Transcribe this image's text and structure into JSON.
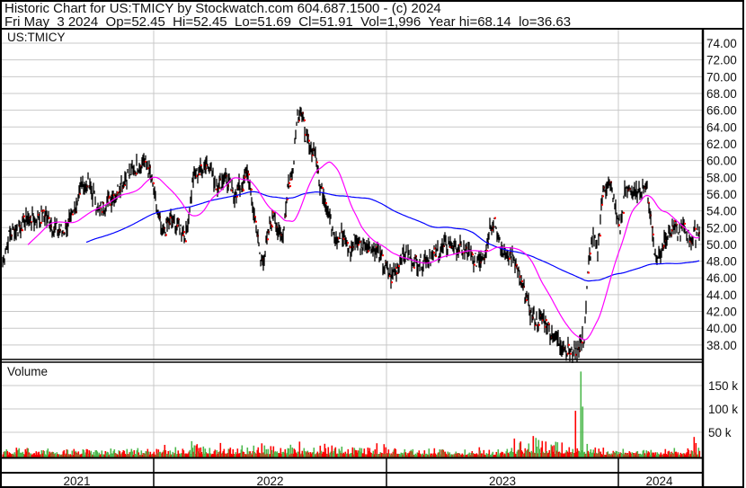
{
  "header": {
    "title": "Historic Chart for US:TMICY by Stockwatch.com 604.687.1500 - (c) 2024",
    "quote": "Fri May  3 2024  Op=52.45  Hi=52.45  Lo=51.69  Cl=51.91  Vol=1,996  Year hi=68.14  lo=36.63"
  },
  "chart_data": {
    "type": "line",
    "title": "US:TMICY",
    "price_panel": {
      "symbol_label": "US:TMICY",
      "ylim": [
        37,
        75
      ],
      "yticks": [
        "74.00",
        "72.00",
        "70.00",
        "68.00",
        "66.00",
        "64.00",
        "62.00",
        "60.00",
        "58.00",
        "56.00",
        "54.00",
        "52.00",
        "50.00",
        "48.00",
        "46.00",
        "44.00",
        "42.00",
        "40.00",
        "38.00"
      ],
      "x_day": [
        0,
        7,
        17,
        27,
        37,
        47,
        57,
        67,
        77,
        87,
        97,
        107,
        117,
        127,
        137,
        147,
        157,
        162,
        167,
        172,
        177,
        187,
        197,
        204,
        212,
        222,
        229,
        237,
        247,
        257,
        267,
        272,
        277,
        282,
        287,
        292,
        297,
        302,
        307,
        312,
        317,
        322,
        327,
        332,
        337,
        342,
        347,
        352,
        357,
        362,
        367,
        372,
        377,
        382,
        387,
        392,
        397,
        407,
        417,
        427,
        432,
        437,
        447,
        457,
        467,
        477,
        487,
        497,
        507,
        517,
        527,
        537,
        542,
        547,
        552,
        557,
        562,
        567,
        572,
        577,
        582,
        587,
        592,
        597,
        602,
        607,
        612,
        617,
        622,
        627,
        632,
        637,
        642,
        647,
        652,
        657,
        662,
        667,
        672,
        677,
        682,
        687,
        692,
        697,
        702,
        707,
        712,
        717,
        722,
        727,
        732,
        737,
        742,
        747,
        752,
        757,
        762,
        767,
        772,
        775
      ],
      "close": [
        48,
        51,
        52,
        53,
        53,
        53.5,
        52,
        51.5,
        53,
        57,
        57,
        54,
        55,
        56.5,
        58,
        59,
        60,
        59,
        57,
        54,
        51,
        53,
        52,
        51,
        58,
        59,
        60,
        57,
        58,
        56,
        57,
        59,
        55,
        52,
        48,
        49,
        52,
        54,
        51,
        51,
        57,
        58,
        65,
        66,
        63,
        61,
        62,
        57,
        56,
        54,
        52,
        51,
        51,
        50,
        49,
        51,
        50,
        50,
        49,
        47,
        46,
        47,
        49,
        48,
        48,
        48.5,
        49.5,
        50,
        49.5,
        49,
        48,
        49,
        52,
        53,
        50,
        49,
        49,
        48.5,
        47,
        45,
        44,
        42,
        41,
        41,
        41,
        40,
        39,
        38.5,
        38,
        37.5,
        37,
        37.5,
        38,
        39,
        48,
        51,
        49,
        56,
        57,
        57,
        54,
        52,
        56,
        57,
        56,
        56,
        57,
        56.5,
        52,
        48,
        49,
        51,
        51.5,
        52,
        51,
        52,
        51,
        50.5,
        51.5,
        51.91
      ],
      "series": [
        {
          "name": "Price bars",
          "color": "#000000",
          "close_marker": "#ff0000"
        },
        {
          "name": "Short moving average",
          "color": "#ff00ff",
          "window": 10
        },
        {
          "name": "Long moving average",
          "color": "#0000ff",
          "window": 40
        }
      ]
    },
    "volume_panel": {
      "label": "Volume",
      "yticks": [
        "150 k",
        "100 k",
        "50 k"
      ],
      "ytick_values": [
        150000,
        100000,
        50000
      ],
      "ylim": [
        0,
        180000
      ],
      "typical_daily": 8000,
      "spikes": [
        {
          "x_day": 590,
          "value": 42000,
          "dir": "down"
        },
        {
          "x_day": 593,
          "value": 38000,
          "dir": "up"
        },
        {
          "x_day": 637,
          "value": 96000,
          "dir": "down"
        },
        {
          "x_day": 643,
          "value": 180000,
          "dir": "up"
        },
        {
          "x_day": 645,
          "value": 105000,
          "dir": "up"
        },
        {
          "x_day": 769,
          "value": 40000,
          "dir": "down"
        },
        {
          "x_day": 771,
          "value": 27000,
          "dir": "down"
        },
        {
          "x_day": 330,
          "value": 30000,
          "dir": "down"
        },
        {
          "x_day": 210,
          "value": 31000,
          "dir": "up"
        }
      ],
      "up_color": "#4cb84c",
      "down_color": "#ff0000"
    },
    "x_axis": {
      "years": [
        {
          "label": "2021",
          "start_day": 0,
          "end_day": 171
        },
        {
          "label": "2022",
          "start_day": 171,
          "end_day": 430
        },
        {
          "label": "2023",
          "start_day": 430,
          "end_day": 688
        },
        {
          "label": "2024",
          "start_day": 688,
          "end_day": 779
        }
      ]
    },
    "grid": true
  }
}
